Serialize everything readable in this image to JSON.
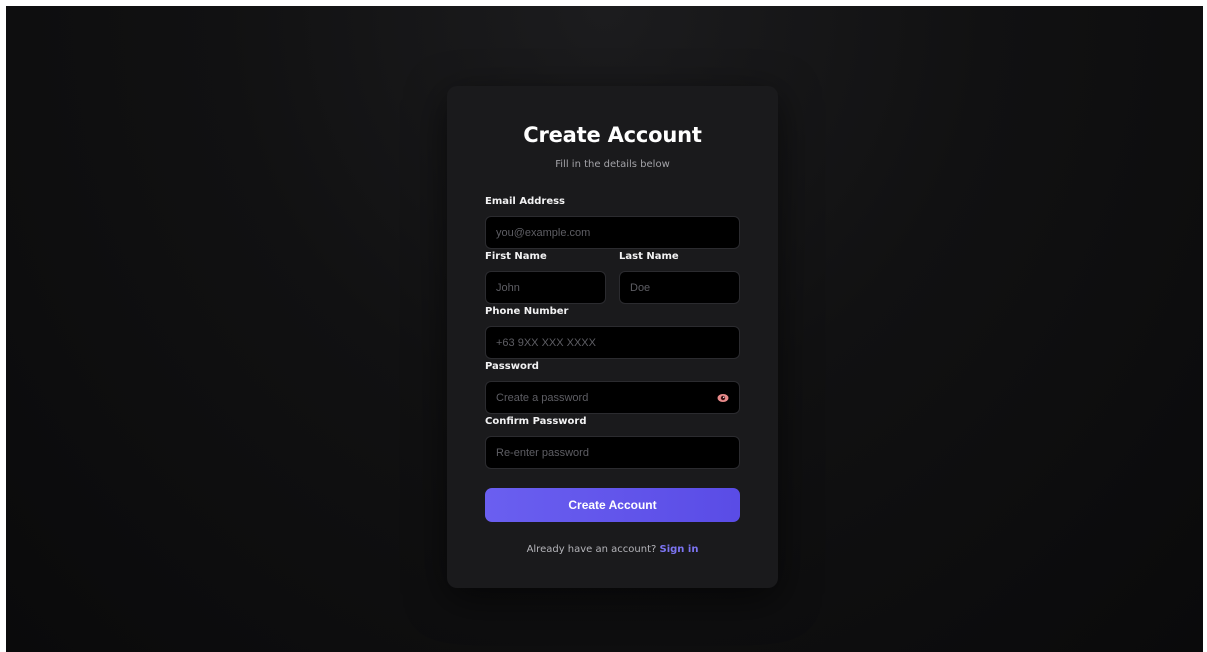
{
  "form": {
    "title": "Create Account",
    "subtitle": "Fill in the details below",
    "email": {
      "label": "Email Address",
      "placeholder": "you@example.com",
      "value": ""
    },
    "first_name": {
      "label": "First Name",
      "placeholder": "John",
      "value": ""
    },
    "last_name": {
      "label": "Last Name",
      "placeholder": "Doe",
      "value": ""
    },
    "phone": {
      "label": "Phone Number",
      "placeholder": "+63 9XX XXX XXXX",
      "value": ""
    },
    "password": {
      "label": "Password",
      "placeholder": "Create a password",
      "value": "",
      "toggle_icon": "eye-icon"
    },
    "confirm_password": {
      "label": "Confirm Password",
      "placeholder": "Re-enter password",
      "value": ""
    },
    "submit_label": "Create Account",
    "footer_text": "Already have an account?",
    "footer_link": "Sign in"
  },
  "colors": {
    "accent": "#5f53ec",
    "link": "#7c74f2",
    "card_background": "#1a1a1c",
    "page_background": "#0e0e0f",
    "eye_icon": "#e88a8a"
  }
}
